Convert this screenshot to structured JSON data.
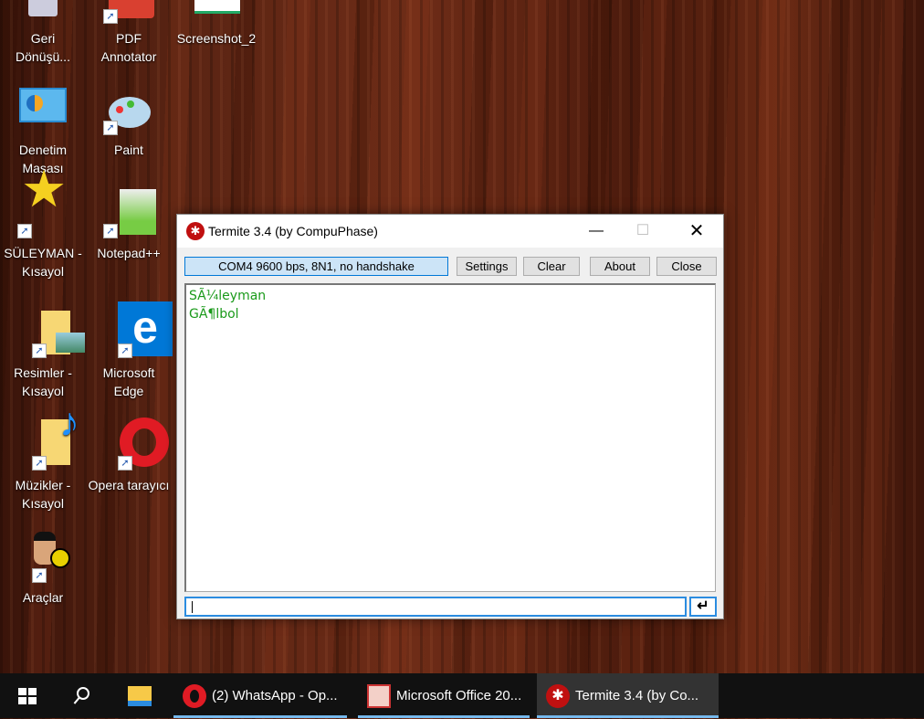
{
  "desktop": {
    "icons": [
      {
        "label": "Geri Dönüşü...",
        "icon": "recycle-bin-icon"
      },
      {
        "label": "PDF Annotator",
        "icon": "pdf-annotator-icon"
      },
      {
        "label": "Screenshot_2",
        "icon": "image-file-icon"
      },
      {
        "label": "Denetim Masası",
        "icon": "control-panel-icon"
      },
      {
        "label": "Paint",
        "icon": "paint-icon"
      },
      {
        "label": "SÜLEYMAN - Kısayol",
        "icon": "star-icon"
      },
      {
        "label": "Notepad++",
        "icon": "notepad-plus-plus-icon"
      },
      {
        "label": "Resimler - Kısayol",
        "icon": "pictures-folder-icon"
      },
      {
        "label": "Microsoft Edge",
        "icon": "edge-icon"
      },
      {
        "label": "Müzikler - Kısayol",
        "icon": "music-folder-icon"
      },
      {
        "label": "Opera tarayıcı",
        "icon": "opera-icon"
      },
      {
        "label": "Araçlar",
        "icon": "users-key-icon"
      }
    ]
  },
  "window": {
    "title": "Termite 3.4 (by CompuPhase)",
    "status": "COM4 9600 bps, 8N1, no handshake",
    "buttons": {
      "settings": "Settings",
      "clear": "Clear",
      "about": "About",
      "close": "Close"
    },
    "terminal_lines": [
      "SÃ¼leyman",
      "GÃ¶lbol"
    ],
    "input_value": ""
  },
  "taskbar": {
    "items": [
      {
        "label": "(2) WhatsApp - Op..."
      },
      {
        "label": "Microsoft Office 20..."
      },
      {
        "label": "Termite 3.4 (by Co..."
      }
    ]
  },
  "colors": {
    "accent": "#2b8ce0",
    "terminal_text": "#1a9a1a",
    "taskbar": "#111111"
  }
}
